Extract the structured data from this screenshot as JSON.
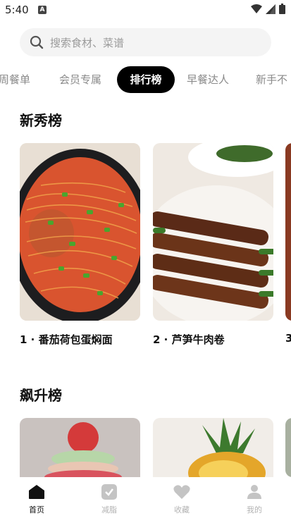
{
  "status_bar": {
    "time": "5:40",
    "notification_glyph": "A"
  },
  "search": {
    "placeholder": "搜索食材、菜谱"
  },
  "tabs": [
    {
      "label": "周餐单",
      "active": false
    },
    {
      "label": "会员专属",
      "active": false
    },
    {
      "label": "排行榜",
      "active": true
    },
    {
      "label": "早餐达人",
      "active": false
    },
    {
      "label": "新手不"
    }
  ],
  "sections": [
    {
      "title": "新秀榜",
      "cards": [
        {
          "caption": "1 · 番茄荷包蛋焖面"
        },
        {
          "caption": "2 · 芦笋牛肉卷"
        },
        {
          "caption": "3"
        }
      ]
    },
    {
      "title": "飙升榜",
      "cards": []
    }
  ],
  "bottom_nav": [
    {
      "label": "首页",
      "icon": "home-icon",
      "active": true
    },
    {
      "label": "减脂",
      "icon": "check-badge-icon",
      "active": false
    },
    {
      "label": "收藏",
      "icon": "heart-icon",
      "active": false
    },
    {
      "label": "我的",
      "icon": "person-icon",
      "active": false
    }
  ],
  "colors": {
    "active_tab_bg": "#000000",
    "inactive_text": "#8a8a8a",
    "nav_inactive": "#b3b3b3"
  }
}
